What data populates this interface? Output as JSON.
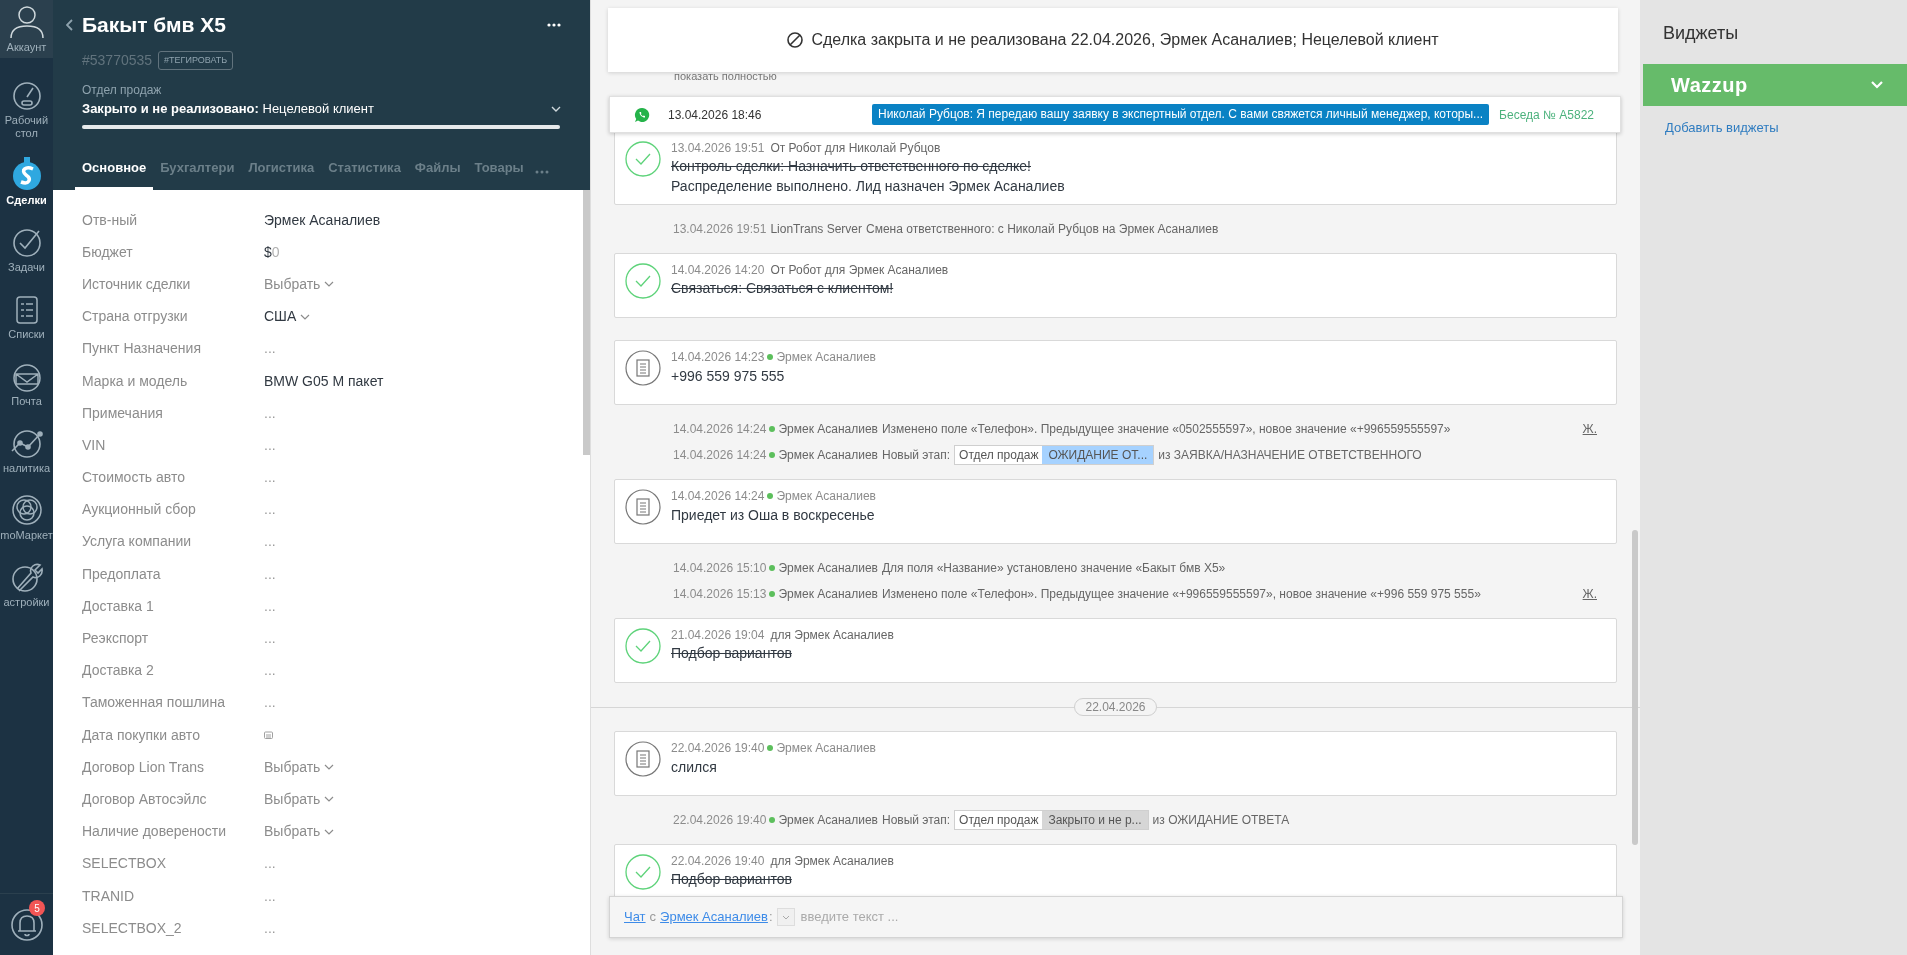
{
  "nav": [
    {
      "label": "Аккаунт",
      "selected": false
    },
    {
      "label": "Рабочий стол",
      "selected": false
    },
    {
      "label": "Сделки",
      "selected": true
    },
    {
      "label": "Задачи",
      "selected": false
    },
    {
      "label": "Списки",
      "selected": false
    },
    {
      "label": "Почта",
      "selected": false
    },
    {
      "label": "налитика",
      "selected": false
    },
    {
      "label": "moМаркет",
      "selected": false
    },
    {
      "label": "астройки",
      "selected": false
    }
  ],
  "notifications": {
    "badge": "5"
  },
  "lead": {
    "title": "Бакыт бмв X5",
    "id": "#53770535",
    "tag_button": "#ТЕГИРОВАТЬ",
    "pipeline": "Отдел продаж",
    "status_bold": "Закрыто и не реализовано:",
    "status": "Нецелевой клиент",
    "level": 1,
    "tabs": [
      {
        "label": "Основное",
        "selected": true
      },
      {
        "label": "Бухгалтери",
        "selected": false
      },
      {
        "label": "Логистика",
        "selected": false
      },
      {
        "label": "Статистика",
        "selected": false
      },
      {
        "label": "Файлы",
        "selected": false
      },
      {
        "label": "Товары",
        "selected": false
      }
    ]
  },
  "fields": [
    {
      "label": "Отв-ный",
      "kind": "text",
      "value": "Эрмек Асаналиев"
    },
    {
      "label": "Бюджет",
      "kind": "money",
      "currency": "$",
      "value": "0"
    },
    {
      "label": "Источник сделки",
      "kind": "select",
      "placeholder": "Выбрать"
    },
    {
      "label": "Страна отгрузки",
      "kind": "select",
      "value": "США"
    },
    {
      "label": "Пункт Назначения",
      "kind": "empty",
      "value": "..."
    },
    {
      "label": "Марка и модель",
      "kind": "text",
      "value": "BMW G05 M пакет"
    },
    {
      "label": "Примечания",
      "kind": "empty",
      "value": "..."
    },
    {
      "label": "VIN",
      "kind": "empty",
      "value": "..."
    },
    {
      "label": "Стоимость авто",
      "kind": "empty",
      "value": "..."
    },
    {
      "label": "Аукционный сбор",
      "kind": "empty",
      "value": "..."
    },
    {
      "label": "Услуга компании",
      "kind": "empty",
      "value": "..."
    },
    {
      "label": "Предоплата",
      "kind": "empty",
      "value": "..."
    },
    {
      "label": "Доставка 1",
      "kind": "empty",
      "value": "..."
    },
    {
      "label": "Реэкспорт",
      "kind": "empty",
      "value": "..."
    },
    {
      "label": "Доставка 2",
      "kind": "empty",
      "value": "..."
    },
    {
      "label": "Таможенная пошлина",
      "kind": "empty",
      "value": "..."
    },
    {
      "label": "Дата покупки авто",
      "kind": "date"
    },
    {
      "label": "Договор Lion Trans",
      "kind": "select",
      "placeholder": "Выбрать"
    },
    {
      "label": "Договор Автосэйлс",
      "kind": "select",
      "placeholder": "Выбрать"
    },
    {
      "label": "Наличие доверености",
      "kind": "select",
      "placeholder": "Выбрать"
    },
    {
      "label": "SELECTBOX",
      "kind": "empty",
      "value": "..."
    },
    {
      "label": "TRANID",
      "kind": "empty",
      "value": "..."
    },
    {
      "label": "SELECTBOX_2",
      "kind": "empty",
      "value": "..."
    }
  ],
  "banner": {
    "text": "Сделка закрыта и не реализована 22.04.2026, Эрмек Асаналиев; Нецелевой клиент"
  },
  "show_full": "показать полностью",
  "whatsapp": {
    "time": "13.04.2026 18:46",
    "message": "Николай Рубцов: Я передаю вашу заявку в экспертный отдел. С вами свяжется личный менеджер, которы...",
    "conversation": "Беседа № A5822"
  },
  "feed": [
    {
      "kind": "task",
      "time": "13.04.2026 19:51",
      "meta": "От Робот для Николай Рубцов",
      "lines": [
        {
          "text": "Контроль сделки: Назначить ответственного по сделке!",
          "done": true
        },
        {
          "text": "Распределение выполнено. Лид назначен Эрмек Асаналиев",
          "done": false
        }
      ]
    },
    {
      "kind": "system",
      "time": "13.04.2026 19:51",
      "author": "LionTrans Server",
      "online": false,
      "text": "Смена ответственного: с Николай Рубцов на Эрмек Асаналиев"
    },
    {
      "kind": "task",
      "time": "14.04.2026 14:20",
      "meta": "От Робот для Эрмек Асаналиев",
      "lines": [
        {
          "text": "Связаться: Связаться с клиентом!",
          "done": true
        }
      ]
    },
    {
      "kind": "note",
      "time": "14.04.2026 14:23",
      "author": "Эрмек Асаналиев",
      "online": true,
      "text": "+996 559 975 555"
    },
    {
      "kind": "system",
      "time": "14.04.2026 14:24",
      "author": "Эрмек Асаналиев",
      "online": true,
      "text": "Изменено поле «Телефон». Предыдущее значение «0502555597», новое значение «+996559555597»",
      "action": "Ж."
    },
    {
      "kind": "stage",
      "time": "14.04.2026 14:24",
      "author": "Эрмек Асаналиев",
      "online": true,
      "label": "Новый этап:",
      "pipeline": "Отдел продаж",
      "stage": "ОЖИДАНИЕ ОТ...",
      "color": "#a6d2ff",
      "from": "из ЗАЯВКА/НАЗНАЧЕНИЕ ОТВЕТСТВЕННОГО"
    },
    {
      "kind": "note",
      "time": "14.04.2026 14:24",
      "author": "Эрмек Асаналиев",
      "online": true,
      "text": "Приедет из Оша в воскресенье"
    },
    {
      "kind": "system",
      "time": "14.04.2026 15:10",
      "author": "Эрмек Асаналиев",
      "online": true,
      "text": "Для поля «Название» установлено значение «Бакыт бмв X5»"
    },
    {
      "kind": "system",
      "time": "14.04.2026 15:13",
      "author": "Эрмек Асаналиев",
      "online": true,
      "text": "Изменено поле «Телефон». Предыдущее значение «+996559555597», новое значение «+996 559 975 555»",
      "action": "Ж."
    },
    {
      "kind": "task",
      "time": "21.04.2026 19:04",
      "meta": "для Эрмек Асаналиев",
      "lines": [
        {
          "text": "Подбор вариантов",
          "done": true
        }
      ]
    },
    {
      "kind": "date",
      "text": "22.04.2026"
    },
    {
      "kind": "note",
      "time": "22.04.2026 19:40",
      "author": "Эрмек Асаналиев",
      "online": true,
      "text": "слился"
    },
    {
      "kind": "stage",
      "time": "22.04.2026 19:40",
      "author": "Эрмек Асаналиев",
      "online": true,
      "label": "Новый этап:",
      "pipeline": "Отдел продаж",
      "stage": "Закрыто и не р...",
      "color": "#d6d6d6",
      "from": "из ОЖИДАНИЕ ОТВЕТА"
    },
    {
      "kind": "task",
      "time": "22.04.2026 19:40",
      "meta": "для Эрмек Асаналиев",
      "lines": [
        {
          "text": "Подбор вариантов",
          "done": true
        }
      ]
    }
  ],
  "chat": {
    "link": "Чат",
    "with": "с",
    "contact": "Эрмек Асаналиев",
    "colon": ":",
    "placeholder": "введите текст ..."
  },
  "widgets": {
    "title": "Виджеты",
    "items": [
      {
        "name": "Wazzup",
        "expanded": false
      }
    ],
    "add": "Добавить виджеты"
  }
}
